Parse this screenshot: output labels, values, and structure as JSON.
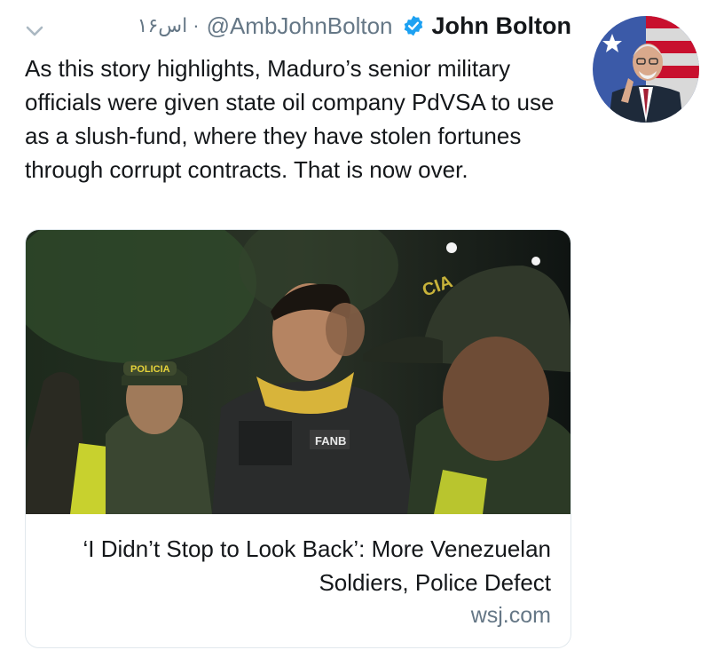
{
  "tweet": {
    "time": "۱۶اس",
    "separator": "·",
    "handle": "@AmbJohnBolton",
    "name": "John Bolton",
    "text": "As this story highlights, Maduro’s senior military officials were given state oil company PdVSA to use as a slush-fund, where they have stolen fortunes through corrupt contracts. That is now over."
  },
  "card": {
    "title": "‘I Didn’t Stop to Look Back’: More Venezuelan Soldiers, Police Defect",
    "domain": "wsj.com",
    "image_labels": {
      "policia": "POLICIA",
      "fanb": "FANB",
      "cap_badge": "CIA"
    }
  },
  "colors": {
    "verified": "#1da1f2",
    "muted": "#657786",
    "text": "#14171a",
    "card_border": "#e1e8ed"
  },
  "icons": {
    "chevron": "chevron-down-icon",
    "verified": "verified-badge-icon"
  }
}
